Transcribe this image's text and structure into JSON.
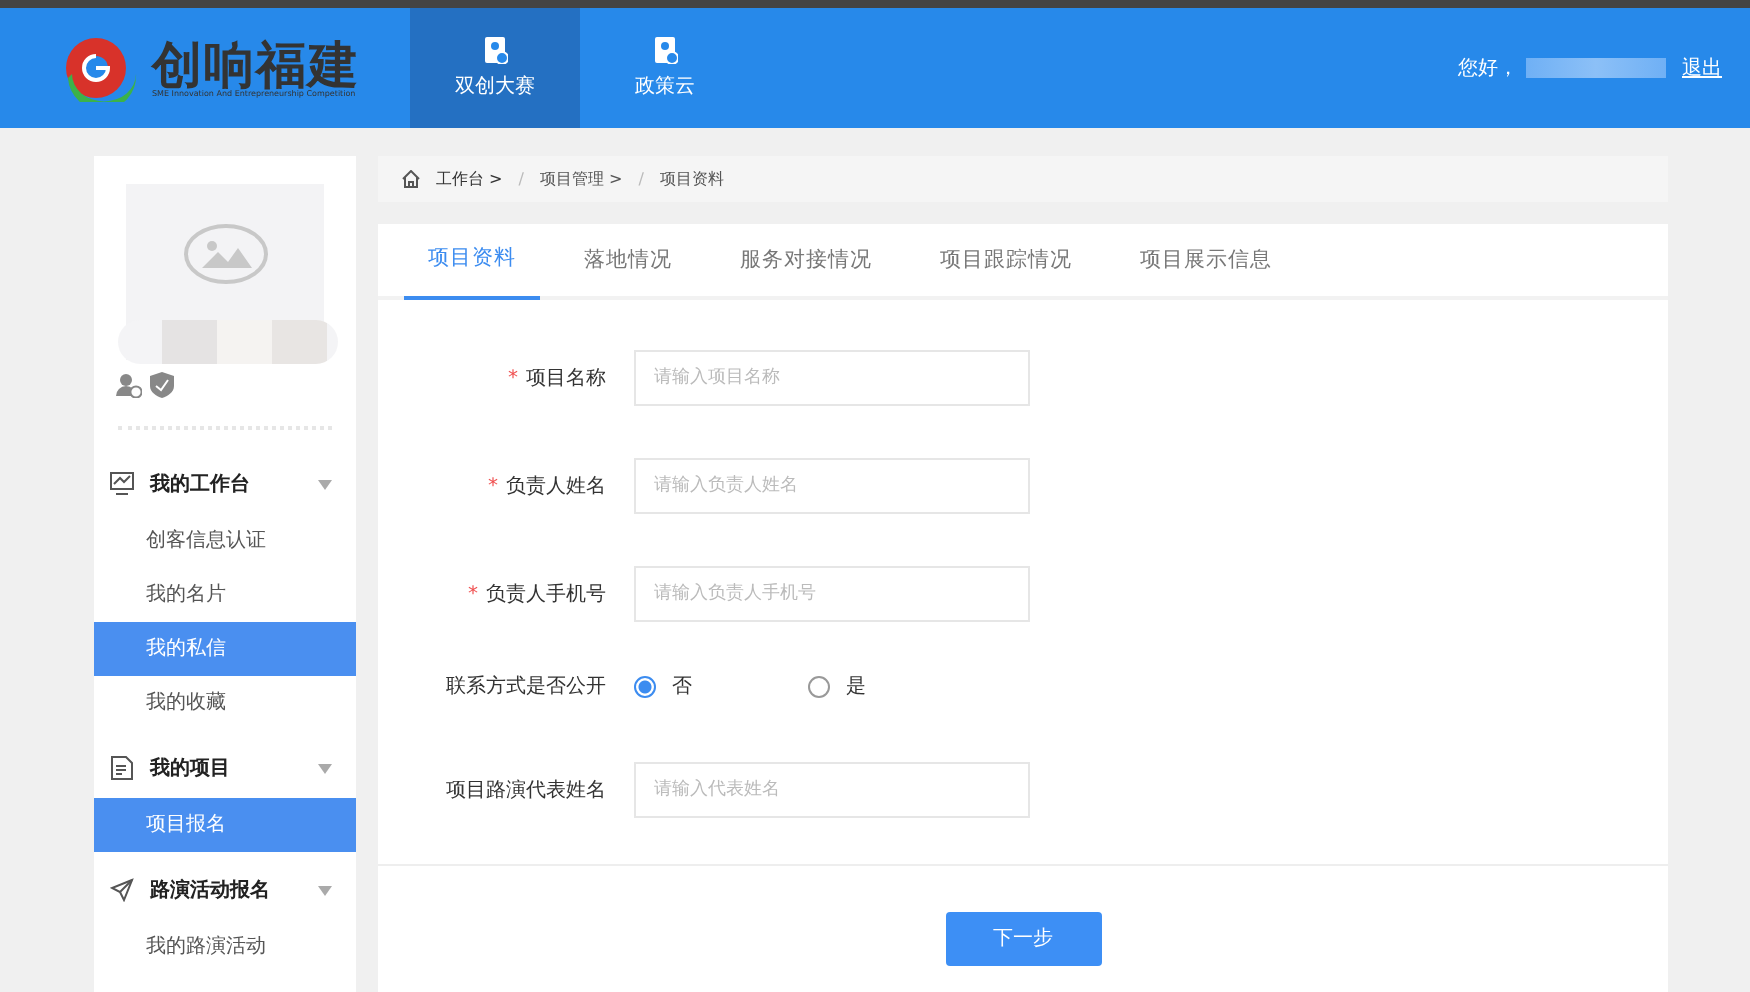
{
  "header": {
    "logo": {
      "title": "创响福建",
      "subtitle": "SME Innovation And Entrepreneurship Competition"
    },
    "nav": [
      {
        "label": "双创大赛",
        "selected": true
      },
      {
        "label": "政策云",
        "selected": false
      }
    ],
    "greeting": "您好，",
    "logout": "退出"
  },
  "sidebar": {
    "groups": [
      {
        "label": "我的工作台",
        "items": [
          {
            "label": "创客信息认证",
            "selected": false
          },
          {
            "label": "我的名片",
            "selected": false
          },
          {
            "label": "我的私信",
            "selected": true
          },
          {
            "label": "我的收藏",
            "selected": false
          }
        ]
      },
      {
        "label": "我的项目",
        "items": [
          {
            "label": "项目报名",
            "selected": true
          }
        ]
      },
      {
        "label": "路演活动报名",
        "items": [
          {
            "label": "我的路演活动",
            "selected": false
          }
        ]
      }
    ]
  },
  "breadcrumb": [
    "工作台 >",
    "/",
    "项目管理 >",
    "/",
    "项目资料"
  ],
  "tabs": [
    {
      "label": "项目资料",
      "selected": true
    },
    {
      "label": "落地情况",
      "selected": false
    },
    {
      "label": "服务对接情况",
      "selected": false
    },
    {
      "label": "项目跟踪情况",
      "selected": false
    },
    {
      "label": "项目展示信息",
      "selected": false
    }
  ],
  "form": [
    {
      "kind": "input",
      "required_mark": "*",
      "label": "项目名称",
      "placeholder": "请输入项目名称"
    },
    {
      "kind": "input",
      "required_mark": "*",
      "label": "负责人姓名",
      "placeholder": "请输入负责人姓名"
    },
    {
      "kind": "input",
      "required_mark": "*",
      "label": "负责人手机号",
      "placeholder": "请输入负责人手机号"
    },
    {
      "kind": "radio",
      "label": "联系方式是否公开",
      "options": [
        {
          "label": "否",
          "selected": true
        },
        {
          "label": "是",
          "selected": false
        }
      ]
    },
    {
      "kind": "input",
      "label": "项目路演代表姓名",
      "placeholder": "请输入代表姓名"
    }
  ],
  "next_button": "下一步"
}
